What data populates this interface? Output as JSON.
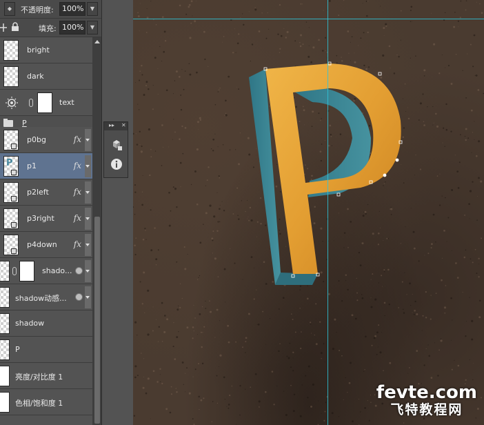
{
  "options": {
    "opacity_label": "不透明度:",
    "opacity_value": "100%",
    "fill_label": "填充:",
    "fill_value": "100%"
  },
  "layers": {
    "bright": "bright",
    "dark": "dark",
    "text": "text",
    "group": "P",
    "p0bg": "p0bg",
    "p1": "p1",
    "p2left": "p2left",
    "p3right": "p3right",
    "p4down": "p4down",
    "shadow_blur": "shado...",
    "shadow_motion": "shadow动感...",
    "shadow": "shadow",
    "p_layer": "P",
    "brightness": "亮度/对比度 1",
    "huesat": "色相/饱和度 1",
    "fx_label": "fx"
  },
  "canvas": {
    "letter": "P",
    "colors": {
      "face": "#E8A53A",
      "side": "#3F8A9A",
      "background": "#4A3B30",
      "guide": "#2EC4D8"
    }
  },
  "watermark": {
    "domain": "fevte.com",
    "site": "飞特教程网"
  },
  "icons": [
    "opacity-stepper-icon",
    "move-icon",
    "lock-icon",
    "brightness-adjustment-icon",
    "chain-link-icon",
    "folder-icon",
    "cube-3d-icon",
    "info-icon",
    "panel-collapse-icon",
    "panel-close-icon"
  ]
}
